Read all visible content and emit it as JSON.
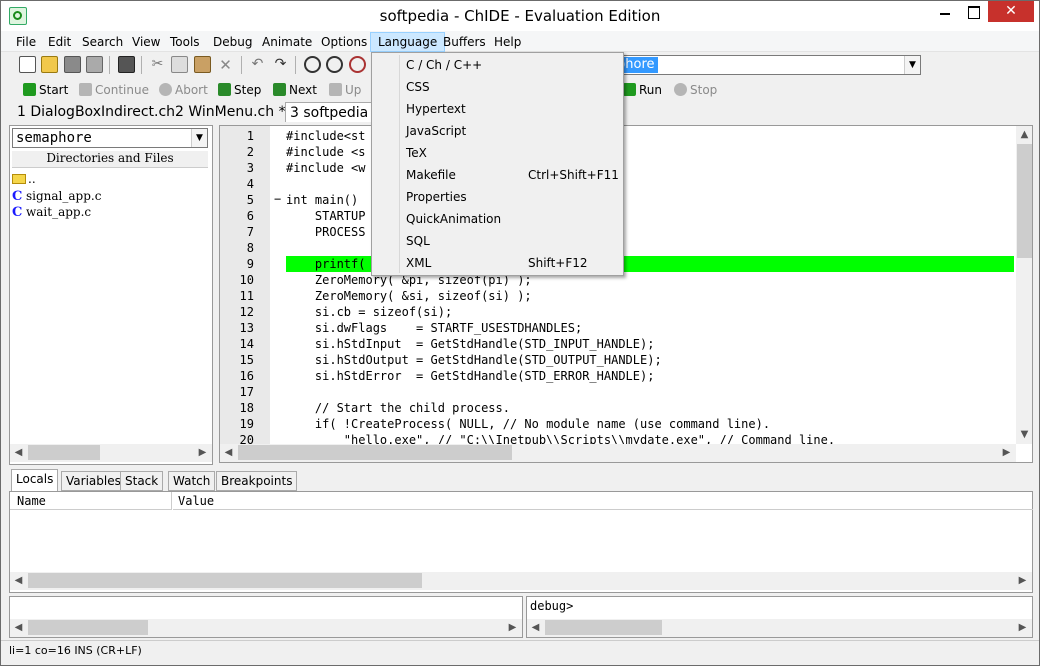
{
  "window": {
    "title": "softpedia - ChIDE - Evaluation Edition"
  },
  "menu": [
    "File",
    "Edit",
    "Search",
    "View",
    "Tools",
    "Debug",
    "Animate",
    "Options",
    "Language",
    "Buffers",
    "Help"
  ],
  "search_combo": {
    "value": "phore"
  },
  "toolbar2": {
    "start": "Start",
    "continue": "Continue",
    "abort": "Abort",
    "step": "Step",
    "next": "Next",
    "up": "Up",
    "run": "Run",
    "stop": "Stop"
  },
  "file_tabs": [
    {
      "label": "1 DialogBoxIndirect.ch"
    },
    {
      "label": "2 WinMenu.ch *"
    },
    {
      "label": "3 softpedia"
    }
  ],
  "left": {
    "dir_combo": "semaphore",
    "header": "Directories and Files",
    "items": [
      {
        "name": ".."
      },
      {
        "name": "signal_app.c"
      },
      {
        "name": "wait_app.c"
      }
    ]
  },
  "editor": {
    "line_numbers": [
      "1",
      "2",
      "3",
      "4",
      "5",
      "6",
      "7",
      "8",
      "9",
      "10",
      "11",
      "12",
      "13",
      "14",
      "15",
      "16",
      "17",
      "18",
      "19",
      "20"
    ],
    "lines": [
      "#include<st",
      "#include <s",
      "#include <w",
      "",
      "int main()",
      "    STARTUP",
      "    PROCESS",
      "",
      "    printf(",
      "    ZeroMemory( &pi, sizeof(pi) );",
      "    ZeroMemory( &si, sizeof(si) );",
      "    si.cb = sizeof(si);",
      "    si.dwFlags    = STARTF_USESTDHANDLES;",
      "    si.hStdInput  = GetStdHandle(STD_INPUT_HANDLE);",
      "    si.hStdOutput = GetStdHandle(STD_OUTPUT_HANDLE);",
      "    si.hStdError  = GetStdHandle(STD_ERROR_HANDLE);",
      "",
      "    // Start the child process.",
      "    if( !CreateProcess( NULL, // No module name (use command line).",
      "        \"hello.exe\", // \"C:\\\\Inetpub\\\\Scripts\\\\mydate.exe\", // Command line."
    ],
    "highlight_color": "#00ff00"
  },
  "bottom_tabs": [
    "Locals",
    "Variables",
    "Stack",
    "Watch",
    "Breakpoints"
  ],
  "locals": {
    "col_name": "Name",
    "col_value": "Value"
  },
  "output": {
    "debug_prompt": "debug>"
  },
  "status": {
    "text": "li=1 co=16 INS (CR+LF)"
  },
  "language_menu": [
    {
      "label": "C / Ch / C++",
      "shortcut": ""
    },
    {
      "label": "CSS",
      "shortcut": ""
    },
    {
      "label": "Hypertext",
      "shortcut": ""
    },
    {
      "label": "JavaScript",
      "shortcut": ""
    },
    {
      "label": "TeX",
      "shortcut": ""
    },
    {
      "label": "Makefile",
      "shortcut": "Ctrl+Shift+F11"
    },
    {
      "label": "Properties",
      "shortcut": ""
    },
    {
      "label": "QuickAnimation",
      "shortcut": ""
    },
    {
      "label": "SQL",
      "shortcut": ""
    },
    {
      "label": "XML",
      "shortcut": "Shift+F12"
    }
  ]
}
